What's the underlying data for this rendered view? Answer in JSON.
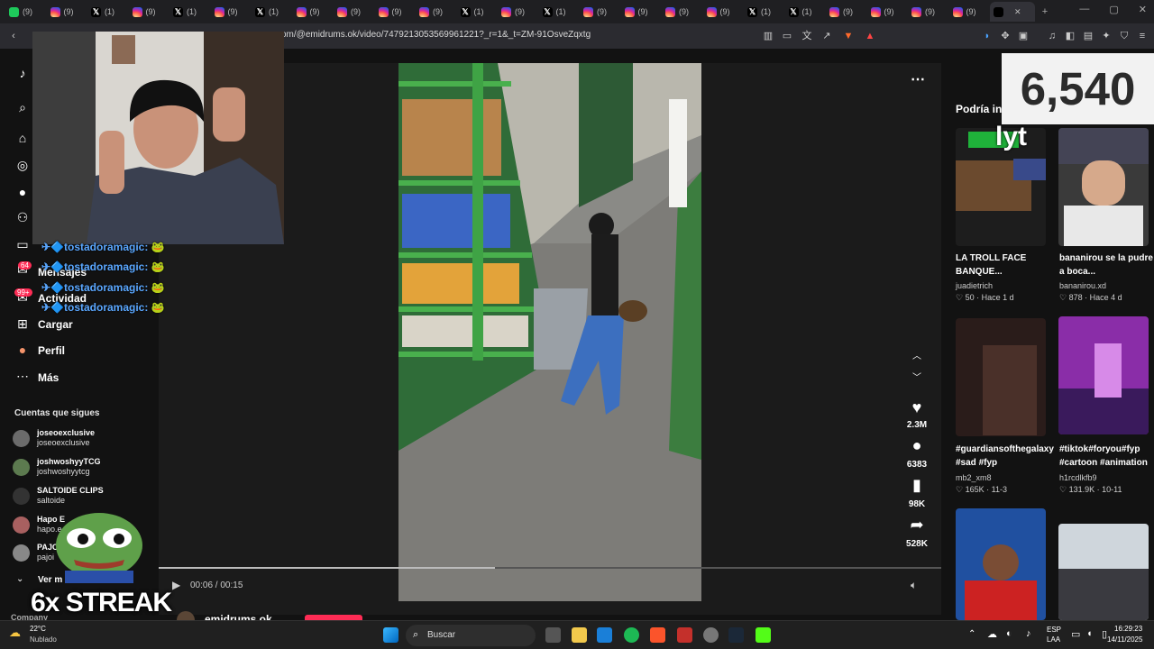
{
  "browser": {
    "tabs": [
      {
        "icon": "green-app-icon",
        "label": "(9)"
      },
      {
        "icon": "instagram-icon",
        "label": "(9)"
      },
      {
        "icon": "x-icon",
        "label": "(1)"
      },
      {
        "icon": "instagram-icon",
        "label": "(9)"
      },
      {
        "icon": "x-icon",
        "label": "(1)"
      },
      {
        "icon": "instagram-icon",
        "label": "(9)"
      },
      {
        "icon": "x-icon",
        "label": "(1)"
      },
      {
        "icon": "instagram-icon",
        "label": "(9)"
      },
      {
        "icon": "instagram-icon",
        "label": "(9)"
      },
      {
        "icon": "instagram-icon",
        "label": "(9)"
      },
      {
        "icon": "instagram-icon",
        "label": "(9)"
      },
      {
        "icon": "x-icon",
        "label": "(1)"
      },
      {
        "icon": "instagram-icon",
        "label": "(9)"
      },
      {
        "icon": "x-icon",
        "label": "(1)"
      },
      {
        "icon": "instagram-icon",
        "label": "(9)"
      },
      {
        "icon": "instagram-icon",
        "label": "(9)"
      },
      {
        "icon": "instagram-icon",
        "label": "(9)"
      },
      {
        "icon": "instagram-icon",
        "label": "(9)"
      },
      {
        "icon": "x-icon",
        "label": "(1)"
      },
      {
        "icon": "x-icon",
        "label": "(1)"
      },
      {
        "icon": "instagram-icon",
        "label": "(9)"
      },
      {
        "icon": "instagram-icon",
        "label": "(9)"
      },
      {
        "icon": "instagram-icon",
        "label": "(9)"
      },
      {
        "icon": "instagram-icon",
        "label": "(9)"
      }
    ],
    "active_tab_close": "✕",
    "new_tab": "+",
    "url": "om/@emidrums.ok/video/7479213053569961221?_r=1&_t=ZM-91OsveZqxtg"
  },
  "tiktok": {
    "nav": {
      "messages": "Mensajes",
      "messages_badge": "64",
      "activity": "Actividad",
      "activity_badge": "99+",
      "upload": "Cargar",
      "profile": "Perfil",
      "more": "Más"
    },
    "following_title": "Cuentas que sigues",
    "following": [
      {
        "name": "joseoexclusive",
        "handle": "joseoexclusive"
      },
      {
        "name": "joshwoshyyTCG",
        "handle": "joshwoshyytcg"
      },
      {
        "name": "SALTOIDE CLIPS",
        "handle": "saltoide"
      },
      {
        "name": "Hapo E",
        "handle": "hapo.e"
      },
      {
        "name": "PAJO",
        "handle": "pajoi"
      }
    ],
    "see_more": "Ver m",
    "company": "Company",
    "author": "emidrums.ok",
    "video": {
      "time": "00:06 / 00:15",
      "progress": 0.43,
      "likes": "2.3M",
      "comments": "6383",
      "saves": "98K",
      "shares": "528K"
    },
    "recs_title": "Podría in",
    "recs": [
      {
        "title": "LA TROLL FACE BANQUE...",
        "author": "juadietrich",
        "likes": "50",
        "date": "Hace 1 d"
      },
      {
        "title": "bananirou se la pudre a boca...",
        "author": "bananirou.xd",
        "likes": "878",
        "date": "Hace 4 d"
      },
      {
        "title": "#guardiansofthegalaxy #sad #fyp",
        "author": "mb2_xm8",
        "likes": "165K",
        "date": "11-3"
      },
      {
        "title": "#tiktok#foryou#fyp #cartoon #animation",
        "author": "h1rcdlkfb9",
        "likes": "131.9K",
        "date": "10-11"
      }
    ]
  },
  "overlay": {
    "chat_user": "tostadoramagic:",
    "counter": "6,540",
    "counter_sub": "lyt",
    "streak": "6x STREAK"
  },
  "taskbar": {
    "weather_temp": "22°C",
    "weather_text": "Nublado",
    "search": "Buscar",
    "lang1": "ESP",
    "lang2": "LAA",
    "time": "16:29:23",
    "date": "14/11/2025"
  }
}
